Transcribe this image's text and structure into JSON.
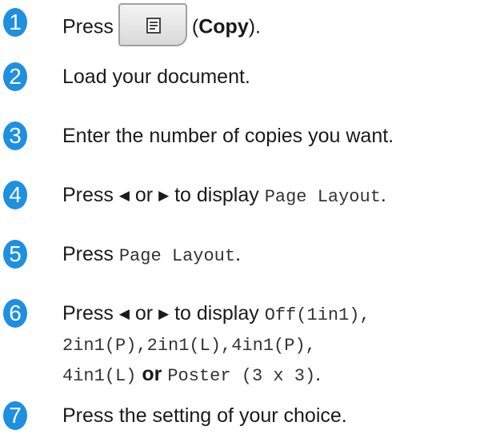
{
  "steps": [
    {
      "number": "1",
      "parts": {
        "press": "Press",
        "open_paren": "(",
        "copy": "Copy",
        "close": ")."
      },
      "button_icon": "copy-document-icon"
    },
    {
      "number": "2",
      "text": "Load your document."
    },
    {
      "number": "3",
      "text": "Enter the number of copies you want."
    },
    {
      "number": "4",
      "parts": {
        "press": "Press",
        "left_arrow": "◀",
        "or": "or",
        "right_arrow": "▶",
        "to_display": "to display",
        "option": "Page Layout",
        "period": "."
      }
    },
    {
      "number": "5",
      "parts": {
        "press": "Press",
        "option": "Page Layout",
        "period": "."
      }
    },
    {
      "number": "6",
      "parts": {
        "press": "Press",
        "left_arrow": "◀",
        "or": "or",
        "right_arrow": "▶",
        "to_display": "to display",
        "opt1": "Off(1in1),",
        "opt2": "2in1(P),",
        "opt3": "2in1(L),",
        "opt4": "4in1(P),",
        "opt5": "4in1(L)",
        "or2": "or",
        "opt6": "Poster (3 x 3)",
        "period": "."
      }
    },
    {
      "number": "7",
      "text": "Press the setting of your choice."
    }
  ]
}
